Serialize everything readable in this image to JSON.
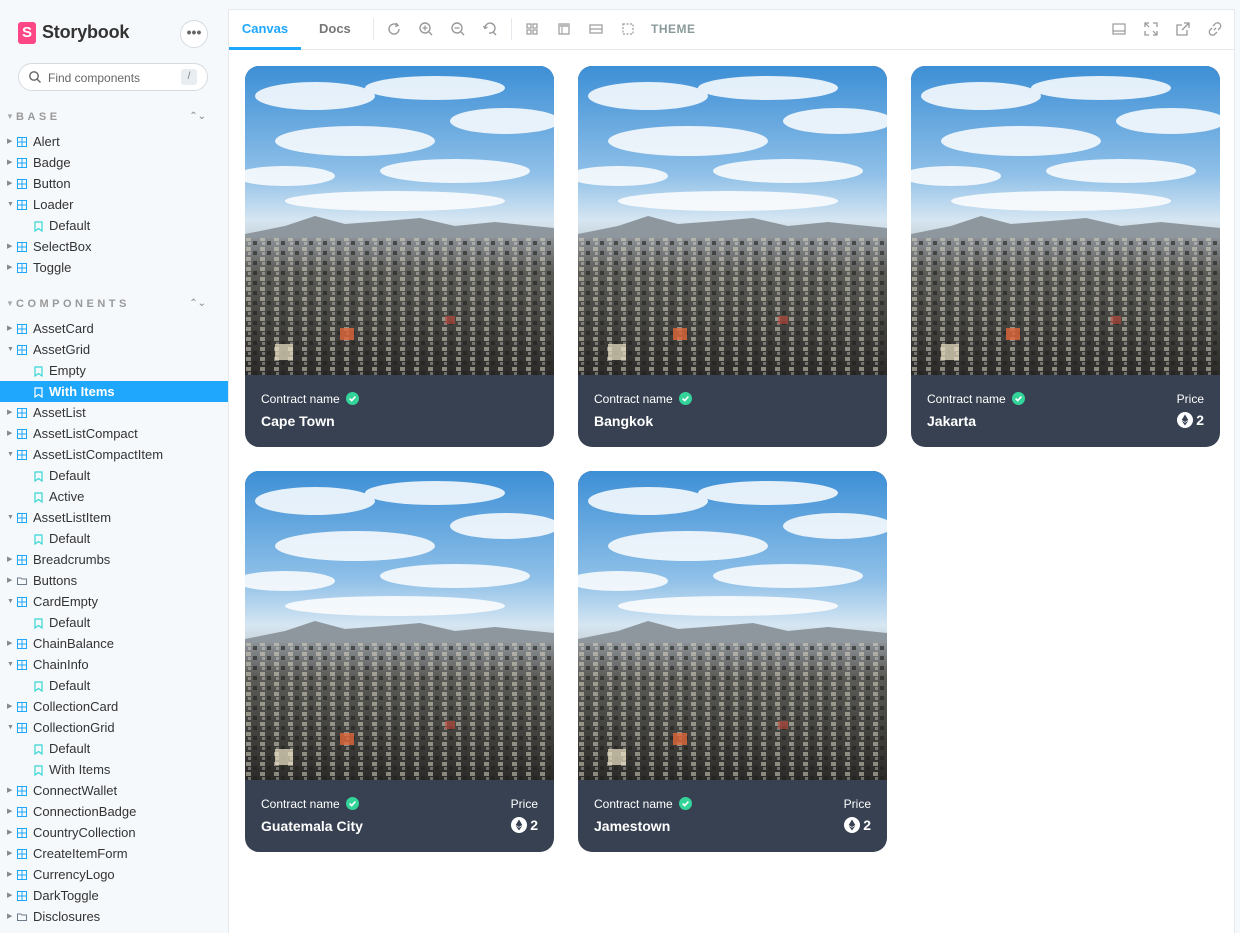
{
  "brand": {
    "logo_letter": "S",
    "name": "Storybook",
    "menu_label": "•••"
  },
  "search": {
    "placeholder": "Find components",
    "shortcut": "/"
  },
  "sections": [
    {
      "title": "BASE"
    },
    {
      "title": "COMPONENTS"
    }
  ],
  "base_items": [
    {
      "label": "Alert"
    },
    {
      "label": "Badge"
    },
    {
      "label": "Button"
    },
    {
      "label": "Loader"
    },
    {
      "label": "Default"
    },
    {
      "label": "SelectBox"
    },
    {
      "label": "Toggle"
    }
  ],
  "component_items": [
    {
      "label": "AssetCard"
    },
    {
      "label": "AssetGrid"
    },
    {
      "label": "Empty"
    },
    {
      "label": "With Items"
    },
    {
      "label": "AssetList"
    },
    {
      "label": "AssetListCompact"
    },
    {
      "label": "AssetListCompactItem"
    },
    {
      "label": "Default"
    },
    {
      "label": "Active"
    },
    {
      "label": "AssetListItem"
    },
    {
      "label": "Default"
    },
    {
      "label": "Breadcrumbs"
    },
    {
      "label": "Buttons"
    },
    {
      "label": "CardEmpty"
    },
    {
      "label": "Default"
    },
    {
      "label": "ChainBalance"
    },
    {
      "label": "ChainInfo"
    },
    {
      "label": "Default"
    },
    {
      "label": "CollectionCard"
    },
    {
      "label": "CollectionGrid"
    },
    {
      "label": "Default"
    },
    {
      "label": "With Items"
    },
    {
      "label": "ConnectWallet"
    },
    {
      "label": "ConnectionBadge"
    },
    {
      "label": "CountryCollection"
    },
    {
      "label": "CreateItemForm"
    },
    {
      "label": "CurrencyLogo"
    },
    {
      "label": "DarkToggle"
    },
    {
      "label": "Disclosures"
    }
  ],
  "toolbar": {
    "tab_canvas": "Canvas",
    "tab_docs": "Docs",
    "theme": "THEME"
  },
  "cards": [
    {
      "contract_label": "Contract name",
      "name": "Cape Town"
    },
    {
      "contract_label": "Contract name",
      "name": "Bangkok"
    },
    {
      "contract_label": "Contract name",
      "name": "Jakarta",
      "price_label": "Price",
      "price": "2"
    },
    {
      "contract_label": "Contract name",
      "name": "Guatemala City",
      "price_label": "Price",
      "price": "2"
    },
    {
      "contract_label": "Contract name",
      "name": "Jamestown",
      "price_label": "Price",
      "price": "2"
    }
  ],
  "colors": {
    "accent": "#1ea7fd",
    "brand": "#ff4785",
    "card_bg": "#374151",
    "verified": "#34d399"
  }
}
